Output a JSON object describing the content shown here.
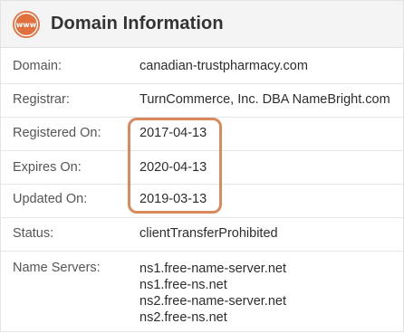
{
  "header": {
    "title": "Domain Information",
    "icon": "www-globe-icon",
    "icon_text": "www",
    "accent_color": "#e2703f"
  },
  "rows": [
    {
      "label": "Domain:",
      "value": "canadian-trustpharmacy.com"
    },
    {
      "label": "Registrar:",
      "value": "TurnCommerce, Inc. DBA NameBright.com"
    },
    {
      "label": "Registered On:",
      "value": "2017-04-13"
    },
    {
      "label": "Expires On:",
      "value": "2020-04-13"
    },
    {
      "label": "Updated On:",
      "value": "2019-03-13"
    },
    {
      "label": "Status:",
      "value": "clientTransferProhibited"
    }
  ],
  "name_servers": {
    "label": "Name Servers:",
    "values": [
      "ns1.free-name-server.net",
      "ns1.free-ns.net",
      "ns2.free-name-server.net",
      "ns2.free-ns.net"
    ]
  },
  "highlight_color": "#d9895c"
}
